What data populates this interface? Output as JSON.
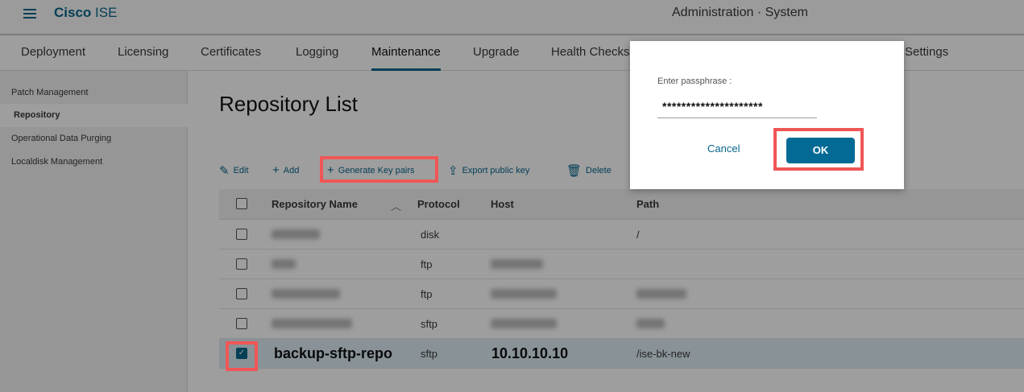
{
  "header": {
    "brand_bold": "Cisco",
    "brand_light": "ISE",
    "page_title": "Administration · System"
  },
  "tabs": [
    {
      "label": "Deployment"
    },
    {
      "label": "Licensing"
    },
    {
      "label": "Certificates"
    },
    {
      "label": "Logging"
    },
    {
      "label": "Maintenance",
      "active": true
    },
    {
      "label": "Upgrade"
    },
    {
      "label": "Health Checks"
    },
    {
      "label": "Settings"
    }
  ],
  "sidebar": {
    "items": [
      {
        "label": "Patch Management"
      },
      {
        "label": "Repository",
        "selected": true
      },
      {
        "label": "Operational Data Purging"
      },
      {
        "label": "Localdisk Management"
      }
    ]
  },
  "main": {
    "title": "Repository List",
    "toolbar": {
      "edit": "Edit",
      "add": "Add",
      "generate": "Generate Key pairs",
      "export": "Export public key",
      "delete": "Delete"
    },
    "columns": {
      "name": "Repository Name",
      "protocol": "Protocol",
      "host": "Host",
      "path": "Path"
    },
    "rows": [
      {
        "protocol": "disk",
        "path": "/"
      },
      {
        "protocol": "ftp"
      },
      {
        "protocol": "ftp"
      },
      {
        "protocol": "sftp"
      },
      {
        "name": "backup-sftp-repo",
        "protocol": "sftp",
        "host": "10.10.10.10",
        "path": "/ise-bk-new",
        "checked": true
      }
    ]
  },
  "dialog": {
    "label": "Enter passphrase :",
    "value": "*********************",
    "cancel": "Cancel",
    "ok": "OK"
  },
  "colors": {
    "accent": "#08668c",
    "highlight": "#f05656",
    "ok_button": "#036a95"
  }
}
